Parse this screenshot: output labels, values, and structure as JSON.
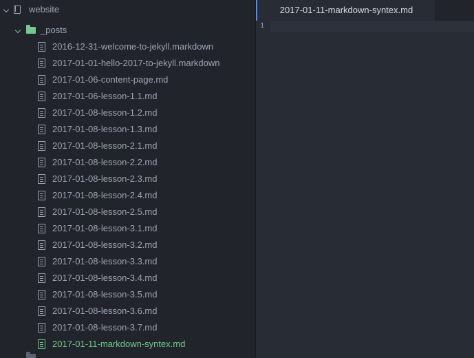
{
  "tree": {
    "root": {
      "label": "website",
      "icon": "repo-icon",
      "expanded": true
    },
    "folder": {
      "label": "_posts",
      "icon": "folder-icon",
      "expanded": true
    },
    "files": [
      {
        "label": "2016-12-31-welcome-to-jekyll.markdown"
      },
      {
        "label": "2017-01-01-hello-2017-to-jekyll.markdown"
      },
      {
        "label": "2017-01-06-content-page.md"
      },
      {
        "label": "2017-01-06-lesson-1.1.md"
      },
      {
        "label": "2017-01-08-lesson-1.2.md"
      },
      {
        "label": "2017-01-08-lesson-1.3.md"
      },
      {
        "label": "2017-01-08-lesson-2.1.md"
      },
      {
        "label": "2017-01-08-lesson-2.2.md"
      },
      {
        "label": "2017-01-08-lesson-2.3.md"
      },
      {
        "label": "2017-01-08-lesson-2.4.md"
      },
      {
        "label": "2017-01-08-lesson-2.5.md"
      },
      {
        "label": "2017-01-08-lesson-3.1.md"
      },
      {
        "label": "2017-01-08-lesson-3.2.md"
      },
      {
        "label": "2017-01-08-lesson-3.3.md"
      },
      {
        "label": "2017-01-08-lesson-3.4.md"
      },
      {
        "label": "2017-01-08-lesson-3.5.md"
      },
      {
        "label": "2017-01-08-lesson-3.6.md"
      },
      {
        "label": "2017-01-08-lesson-3.7.md"
      },
      {
        "label": "2017-01-11-markdown-syntex.md",
        "selected": true
      }
    ]
  },
  "editor": {
    "tab": {
      "title": "2017-01-11-markdown-syntex.md",
      "active": true
    },
    "gutter": {
      "line_number": "1"
    }
  },
  "colors": {
    "background": "#21252b",
    "editor_background": "#282c34",
    "text": "#9da5b4",
    "accent_green": "#73c990",
    "tab_accent": "#528bff"
  }
}
